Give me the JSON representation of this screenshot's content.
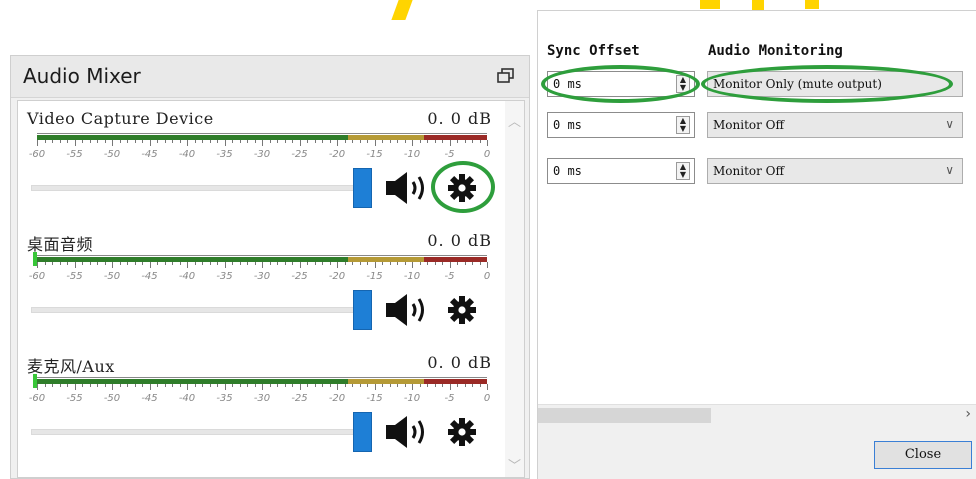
{
  "mixer": {
    "title": "Audio Mixer",
    "tick_labels": [
      "-60",
      "-55",
      "-50",
      "-45",
      "-40",
      "-35",
      "-30",
      "-25",
      "-20",
      "-15",
      "-10",
      "-5",
      "0"
    ],
    "channels": [
      {
        "name": "Video Capture Device",
        "db": "0. 0  dB",
        "highlight_gear": true
      },
      {
        "name": "桌面音频",
        "db": "0. 0  dB",
        "highlight_gear": false
      },
      {
        "name": "麦克风/Aux",
        "db": "0. 0  dB",
        "highlight_gear": false
      }
    ],
    "icons": {
      "speaker": "speaker-icon",
      "gear": "gear-icon",
      "float": "float-window-icon"
    }
  },
  "properties": {
    "headers": {
      "sync_offset": "Sync Offset",
      "audio_monitoring": "Audio Monitoring"
    },
    "rows": [
      {
        "sync_offset": "0 ms",
        "monitoring": "Monitor Only (mute output)",
        "highlighted": true
      },
      {
        "sync_offset": "0 ms",
        "monitoring": "Monitor Off",
        "highlighted": false
      },
      {
        "sync_offset": "0 ms",
        "monitoring": "Monitor Off",
        "highlighted": false
      }
    ],
    "close_label": "Close"
  },
  "colors": {
    "accent_green": "#2e9e3c",
    "fader_blue": "#1e7fd6",
    "meter_green": "#2f7d2a",
    "meter_yellow": "#b59a36",
    "meter_red": "#9a2a26"
  }
}
